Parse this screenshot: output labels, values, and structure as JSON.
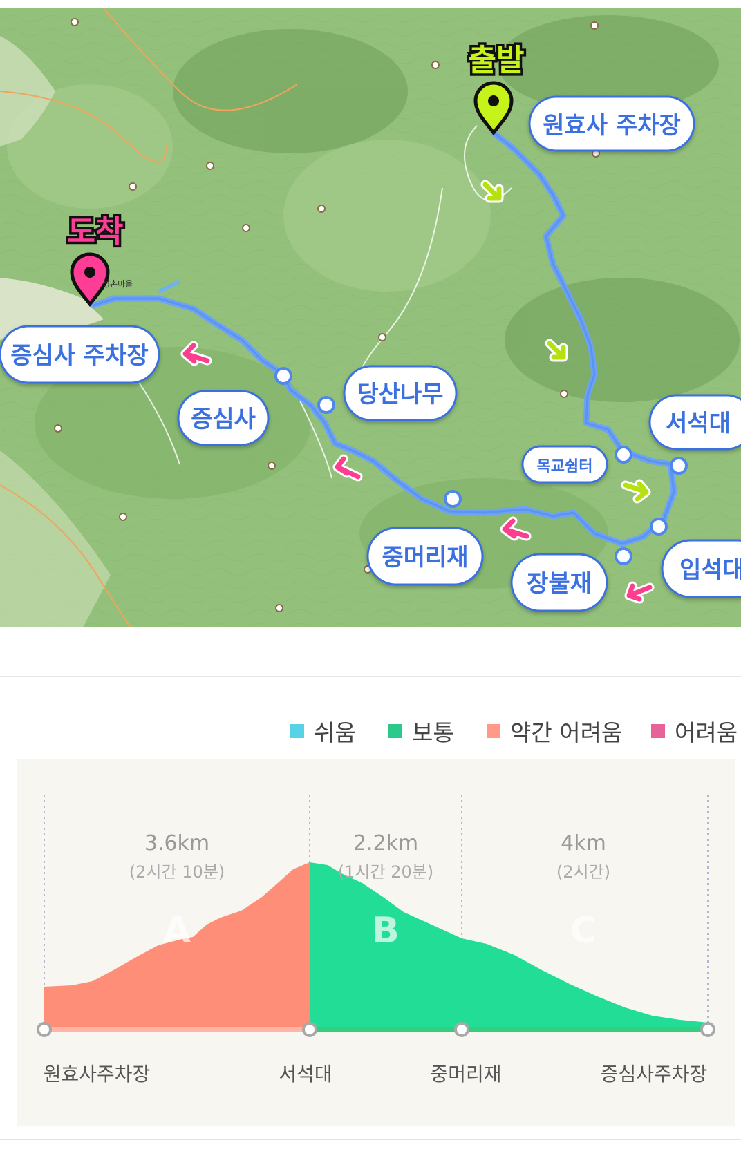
{
  "map": {
    "start_label": "출발",
    "end_label": "도착",
    "start_color": "#c6f31a",
    "end_color": "#ff3d96",
    "route_color": "#5d95f2",
    "callouts": {
      "wonhyosa_parking": "원효사 주차장",
      "seoseokdae": "서석대",
      "mokgyo_shelter": "목교쉼터",
      "ipseokdae": "입석대",
      "jangbuljae": "장불재",
      "jungmeorijae": "중머리재",
      "dangsannamu": "당산나무",
      "jeungsimsa": "증심사",
      "jeungsimsa_parking": "증심사 주차장"
    },
    "place_names": {
      "village": "성촌마을"
    }
  },
  "legend": [
    {
      "label": "쉬움",
      "color": "#57d2e6"
    },
    {
      "label": "보통",
      "color": "#2dc98a"
    },
    {
      "label": "약간 어려움",
      "color": "#ff9a87"
    },
    {
      "label": "어려움",
      "color": "#e8629a"
    }
  ],
  "profile": {
    "sections": [
      {
        "letter": "A",
        "distance": "3.6km",
        "time": "(2시간 10분)",
        "level": "약간 어려움"
      },
      {
        "letter": "B",
        "distance": "2.2km",
        "time": "(1시간 20분)",
        "level": "보통"
      },
      {
        "letter": "C",
        "distance": "4km",
        "time": "(2시간)",
        "level": "보통"
      }
    ],
    "points": [
      "원효사주차장",
      "서석대",
      "중머리재",
      "증심사주차장"
    ],
    "colors": {
      "section_a": "#ff8e78",
      "section_bc": "#22dd96",
      "base_a": "#ffb5a6",
      "base_bc": "#33cf7f"
    }
  }
}
